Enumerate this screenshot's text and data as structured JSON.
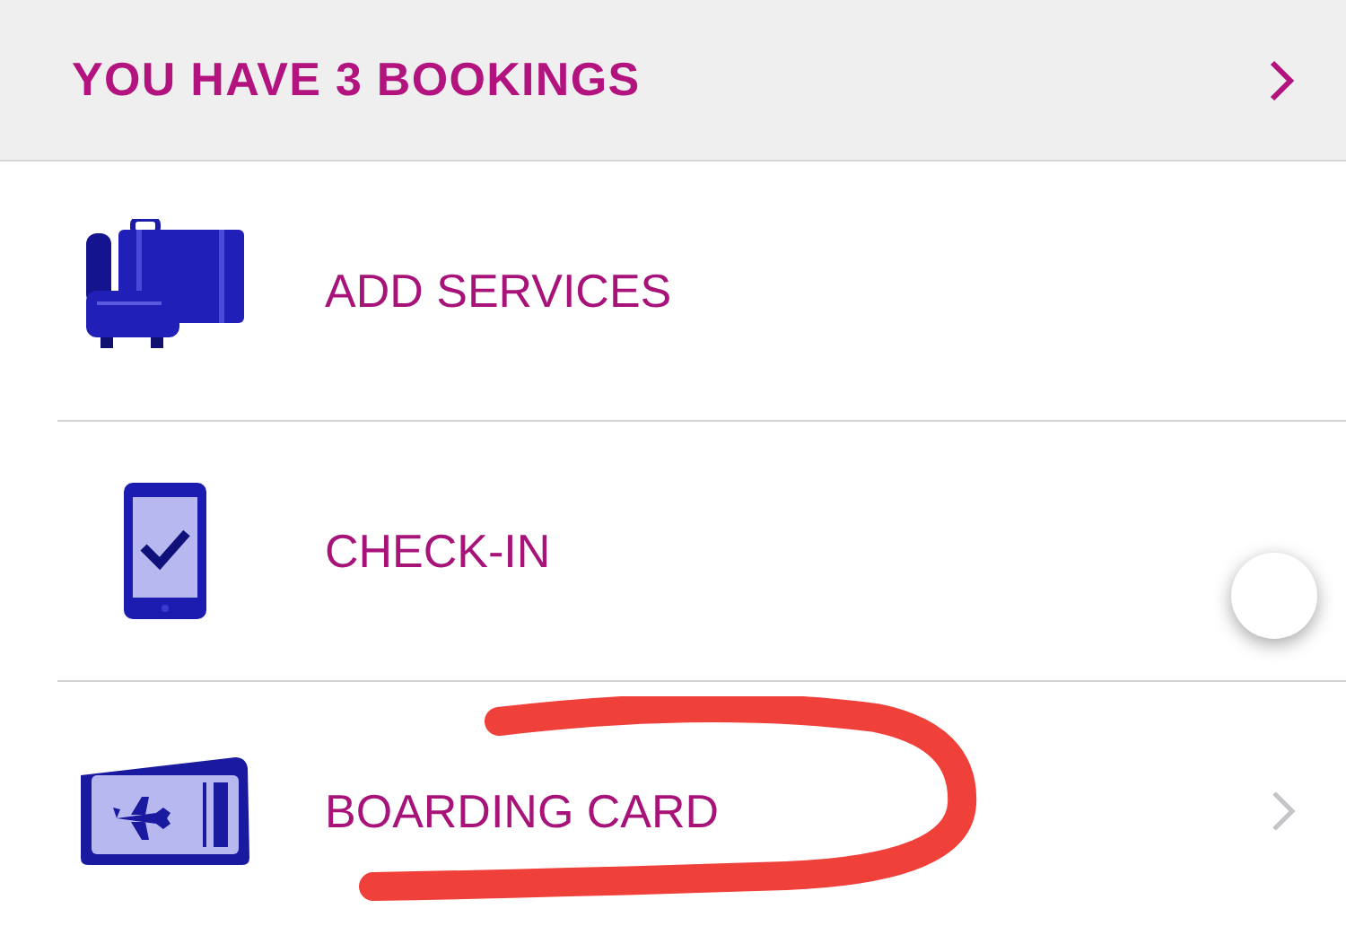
{
  "header": {
    "title": "YOU HAVE 3 BOOKINGS"
  },
  "items": [
    {
      "kind": "services",
      "label": "ADD SERVICES",
      "chevron": false
    },
    {
      "kind": "checkin",
      "label": "CHECK-IN",
      "chevron": false
    },
    {
      "kind": "boarding",
      "label": "BOARDING CARD",
      "chevron": true
    }
  ]
}
